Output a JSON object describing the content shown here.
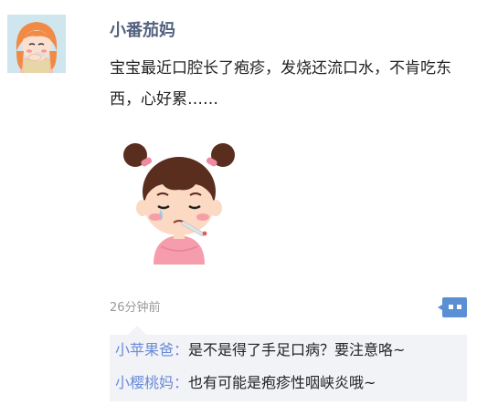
{
  "post": {
    "author": "小番茄妈",
    "text": "宝宝最近口腔长了疱疹，发烧还流口水，不肯吃东西，心好累……",
    "time": "26分钟前"
  },
  "avatar": {
    "icon": "girl-with-thermometer-avatar"
  },
  "photo": {
    "icon": "sick-girl-with-thermometer-cartoon"
  },
  "more_button": {
    "icon": "comment-more-dots-icon"
  },
  "comments": [
    {
      "author": "小苹果爸",
      "separator": "：",
      "text": "是不是得了手足口病？要注意咯~"
    },
    {
      "author": "小樱桃妈",
      "separator": "：",
      "text": "也有可能是疱疹性咽峡炎哦~"
    }
  ],
  "colors": {
    "author_name": "#54627f",
    "comment_author": "#6a8bd8",
    "comment_bg": "#f1f3f7",
    "more_button": "#5a8fd3"
  }
}
